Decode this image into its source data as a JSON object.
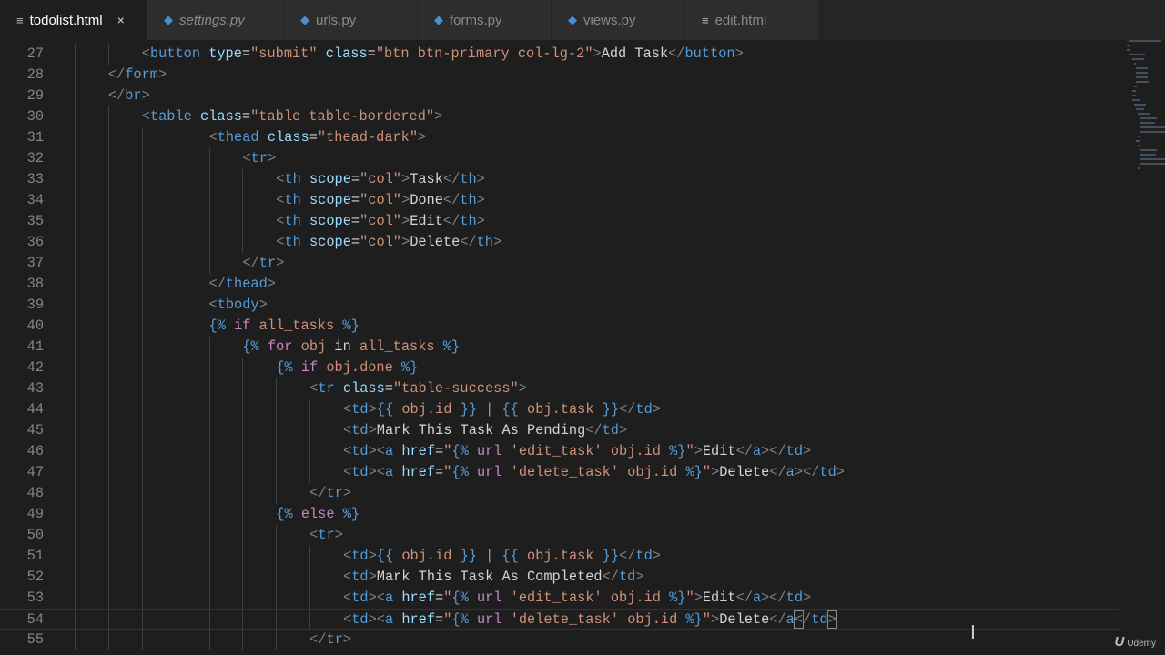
{
  "tabs": [
    {
      "label": "todolist.html",
      "icon": "file-lines-icon",
      "active": true,
      "close": "×"
    },
    {
      "label": "settings.py",
      "icon": "python-icon",
      "italic": true
    },
    {
      "label": "urls.py",
      "icon": "python-icon"
    },
    {
      "label": "forms.py",
      "icon": "python-icon"
    },
    {
      "label": "views.py",
      "icon": "python-icon"
    },
    {
      "label": "edit.html",
      "icon": "file-lines-icon"
    }
  ],
  "lines": [
    {
      "n": "27",
      "i": 8,
      "tk": [
        [
          "p",
          "<"
        ],
        [
          "t",
          "button"
        ],
        [
          "x",
          " "
        ],
        [
          "a",
          "type"
        ],
        [
          "x",
          "="
        ],
        [
          "s",
          "\"submit\""
        ],
        [
          "x",
          " "
        ],
        [
          "a",
          "class"
        ],
        [
          "x",
          "="
        ],
        [
          "s",
          "\"btn btn-primary col-lg-2\""
        ],
        [
          "p",
          ">"
        ],
        [
          "x",
          "Add Task"
        ],
        [
          "p",
          "</"
        ],
        [
          "t",
          "button"
        ],
        [
          "p",
          ">"
        ]
      ]
    },
    {
      "n": "28",
      "i": 4,
      "tk": [
        [
          "p",
          "</"
        ],
        [
          "t",
          "form"
        ],
        [
          "p",
          ">"
        ]
      ]
    },
    {
      "n": "29",
      "i": 4,
      "tk": [
        [
          "p",
          "</"
        ],
        [
          "t",
          "br"
        ],
        [
          "p",
          ">"
        ]
      ]
    },
    {
      "n": "30",
      "i": 8,
      "tk": [
        [
          "p",
          "<"
        ],
        [
          "t",
          "table"
        ],
        [
          "x",
          " "
        ],
        [
          "a",
          "class"
        ],
        [
          "x",
          "="
        ],
        [
          "s",
          "\"table table-bordered\""
        ],
        [
          "p",
          ">"
        ]
      ]
    },
    {
      "n": "31",
      "i": 16,
      "tk": [
        [
          "p",
          "<"
        ],
        [
          "t",
          "thead"
        ],
        [
          "x",
          " "
        ],
        [
          "a",
          "class"
        ],
        [
          "x",
          "="
        ],
        [
          "s",
          "\"thead-dark\""
        ],
        [
          "p",
          ">"
        ]
      ]
    },
    {
      "n": "32",
      "i": 20,
      "tk": [
        [
          "p",
          "<"
        ],
        [
          "t",
          "tr"
        ],
        [
          "p",
          ">"
        ]
      ]
    },
    {
      "n": "33",
      "i": 24,
      "tk": [
        [
          "p",
          "<"
        ],
        [
          "t",
          "th"
        ],
        [
          "x",
          " "
        ],
        [
          "a",
          "scope"
        ],
        [
          "x",
          "="
        ],
        [
          "s",
          "\"col\""
        ],
        [
          "p",
          ">"
        ],
        [
          "x",
          "Task"
        ],
        [
          "p",
          "</"
        ],
        [
          "t",
          "th"
        ],
        [
          "p",
          ">"
        ]
      ]
    },
    {
      "n": "34",
      "i": 24,
      "tk": [
        [
          "p",
          "<"
        ],
        [
          "t",
          "th"
        ],
        [
          "x",
          " "
        ],
        [
          "a",
          "scope"
        ],
        [
          "x",
          "="
        ],
        [
          "s",
          "\"col\""
        ],
        [
          "p",
          ">"
        ],
        [
          "x",
          "Done"
        ],
        [
          "p",
          "</"
        ],
        [
          "t",
          "th"
        ],
        [
          "p",
          ">"
        ]
      ]
    },
    {
      "n": "35",
      "i": 24,
      "tk": [
        [
          "p",
          "<"
        ],
        [
          "t",
          "th"
        ],
        [
          "x",
          " "
        ],
        [
          "a",
          "scope"
        ],
        [
          "x",
          "="
        ],
        [
          "s",
          "\"col\""
        ],
        [
          "p",
          ">"
        ],
        [
          "x",
          "Edit"
        ],
        [
          "p",
          "</"
        ],
        [
          "t",
          "th"
        ],
        [
          "p",
          ">"
        ]
      ]
    },
    {
      "n": "36",
      "i": 24,
      "tk": [
        [
          "p",
          "<"
        ],
        [
          "t",
          "th"
        ],
        [
          "x",
          " "
        ],
        [
          "a",
          "scope"
        ],
        [
          "x",
          "="
        ],
        [
          "s",
          "\"col\""
        ],
        [
          "p",
          ">"
        ],
        [
          "x",
          "Delete"
        ],
        [
          "p",
          "</"
        ],
        [
          "t",
          "th"
        ],
        [
          "p",
          ">"
        ]
      ]
    },
    {
      "n": "37",
      "i": 20,
      "tk": [
        [
          "p",
          "</"
        ],
        [
          "t",
          "tr"
        ],
        [
          "p",
          ">"
        ]
      ]
    },
    {
      "n": "38",
      "i": 16,
      "tk": [
        [
          "p",
          "</"
        ],
        [
          "t",
          "thead"
        ],
        [
          "p",
          ">"
        ]
      ]
    },
    {
      "n": "39",
      "i": 16,
      "tk": [
        [
          "p",
          "<"
        ],
        [
          "t",
          "tbody"
        ],
        [
          "p",
          ">"
        ]
      ]
    },
    {
      "n": "40",
      "i": 16,
      "tk": [
        [
          "d",
          "{%"
        ],
        [
          "x",
          " "
        ],
        [
          "k",
          "if"
        ],
        [
          "x",
          " "
        ],
        [
          "v",
          "all_tasks"
        ],
        [
          "x",
          " "
        ],
        [
          "d",
          "%}"
        ]
      ]
    },
    {
      "n": "41",
      "i": 20,
      "tk": [
        [
          "d",
          "{%"
        ],
        [
          "x",
          " "
        ],
        [
          "k",
          "for"
        ],
        [
          "x",
          " "
        ],
        [
          "v",
          "obj"
        ],
        [
          "x",
          " in "
        ],
        [
          "v",
          "all_tasks"
        ],
        [
          "x",
          " "
        ],
        [
          "d",
          "%}"
        ]
      ]
    },
    {
      "n": "42",
      "i": 24,
      "tk": [
        [
          "d",
          "{%"
        ],
        [
          "x",
          " "
        ],
        [
          "k",
          "if"
        ],
        [
          "x",
          " "
        ],
        [
          "v",
          "obj.done"
        ],
        [
          "x",
          " "
        ],
        [
          "d",
          "%}"
        ]
      ]
    },
    {
      "n": "43",
      "i": 28,
      "tk": [
        [
          "p",
          "<"
        ],
        [
          "t",
          "tr"
        ],
        [
          "x",
          " "
        ],
        [
          "a",
          "class"
        ],
        [
          "x",
          "="
        ],
        [
          "s",
          "\"table-success\""
        ],
        [
          "p",
          ">"
        ]
      ]
    },
    {
      "n": "44",
      "i": 32,
      "tk": [
        [
          "p",
          "<"
        ],
        [
          "t",
          "td"
        ],
        [
          "p",
          ">"
        ],
        [
          "d",
          "{{"
        ],
        [
          "x",
          " "
        ],
        [
          "v",
          "obj.id"
        ],
        [
          "x",
          " "
        ],
        [
          "d",
          "}}"
        ],
        [
          "x",
          " "
        ],
        [
          "k",
          "|"
        ],
        [
          "x",
          " "
        ],
        [
          "d",
          "{{"
        ],
        [
          "x",
          " "
        ],
        [
          "v",
          "obj.task"
        ],
        [
          "x",
          " "
        ],
        [
          "d",
          "}}"
        ],
        [
          "p",
          "</"
        ],
        [
          "t",
          "td"
        ],
        [
          "p",
          ">"
        ]
      ]
    },
    {
      "n": "45",
      "i": 32,
      "tk": [
        [
          "p",
          "<"
        ],
        [
          "t",
          "td"
        ],
        [
          "p",
          ">"
        ],
        [
          "x",
          "Mark This Task As Pending"
        ],
        [
          "p",
          "</"
        ],
        [
          "t",
          "td"
        ],
        [
          "p",
          ">"
        ]
      ]
    },
    {
      "n": "46",
      "i": 32,
      "tk": [
        [
          "p",
          "<"
        ],
        [
          "t",
          "td"
        ],
        [
          "p",
          "><"
        ],
        [
          "t",
          "a"
        ],
        [
          "x",
          " "
        ],
        [
          "a",
          "href"
        ],
        [
          "x",
          "="
        ],
        [
          "s",
          "\""
        ],
        [
          "d",
          "{%"
        ],
        [
          "x",
          " "
        ],
        [
          "k",
          "url"
        ],
        [
          "x",
          " "
        ],
        [
          "s",
          "'edit_task'"
        ],
        [
          "x",
          " "
        ],
        [
          "v",
          "obj.id"
        ],
        [
          "x",
          " "
        ],
        [
          "d",
          "%}"
        ],
        [
          "s",
          "\""
        ],
        [
          "p",
          ">"
        ],
        [
          "x",
          "Edit"
        ],
        [
          "p",
          "</"
        ],
        [
          "t",
          "a"
        ],
        [
          "p",
          "></"
        ],
        [
          "t",
          "td"
        ],
        [
          "p",
          ">"
        ]
      ]
    },
    {
      "n": "47",
      "i": 32,
      "tk": [
        [
          "p",
          "<"
        ],
        [
          "t",
          "td"
        ],
        [
          "p",
          "><"
        ],
        [
          "t",
          "a"
        ],
        [
          "x",
          " "
        ],
        [
          "a",
          "href"
        ],
        [
          "x",
          "="
        ],
        [
          "s",
          "\""
        ],
        [
          "d",
          "{%"
        ],
        [
          "x",
          " "
        ],
        [
          "k",
          "url"
        ],
        [
          "x",
          " "
        ],
        [
          "s",
          "'delete_task'"
        ],
        [
          "x",
          " "
        ],
        [
          "v",
          "obj.id"
        ],
        [
          "x",
          " "
        ],
        [
          "d",
          "%}"
        ],
        [
          "s",
          "\""
        ],
        [
          "p",
          ">"
        ],
        [
          "x",
          "Delete"
        ],
        [
          "p",
          "</"
        ],
        [
          "t",
          "a"
        ],
        [
          "p",
          "></"
        ],
        [
          "t",
          "td"
        ],
        [
          "p",
          ">"
        ]
      ]
    },
    {
      "n": "48",
      "i": 28,
      "tk": [
        [
          "p",
          "</"
        ],
        [
          "t",
          "tr"
        ],
        [
          "p",
          ">"
        ]
      ]
    },
    {
      "n": "49",
      "i": 24,
      "tk": [
        [
          "d",
          "{%"
        ],
        [
          "x",
          " "
        ],
        [
          "k",
          "else"
        ],
        [
          "x",
          " "
        ],
        [
          "d",
          "%}"
        ]
      ]
    },
    {
      "n": "50",
      "i": 28,
      "tk": [
        [
          "p",
          "<"
        ],
        [
          "t",
          "tr"
        ],
        [
          "p",
          ">"
        ]
      ]
    },
    {
      "n": "51",
      "i": 32,
      "tk": [
        [
          "p",
          "<"
        ],
        [
          "t",
          "td"
        ],
        [
          "p",
          ">"
        ],
        [
          "d",
          "{{"
        ],
        [
          "x",
          " "
        ],
        [
          "v",
          "obj.id"
        ],
        [
          "x",
          " "
        ],
        [
          "d",
          "}}"
        ],
        [
          "x",
          " "
        ],
        [
          "k",
          "|"
        ],
        [
          "x",
          " "
        ],
        [
          "d",
          "{{"
        ],
        [
          "x",
          " "
        ],
        [
          "v",
          "obj.task"
        ],
        [
          "x",
          " "
        ],
        [
          "d",
          "}}"
        ],
        [
          "p",
          "</"
        ],
        [
          "t",
          "td"
        ],
        [
          "p",
          ">"
        ]
      ]
    },
    {
      "n": "52",
      "i": 32,
      "tk": [
        [
          "p",
          "<"
        ],
        [
          "t",
          "td"
        ],
        [
          "p",
          ">"
        ],
        [
          "x",
          "Mark This Task As Completed"
        ],
        [
          "p",
          "</"
        ],
        [
          "t",
          "td"
        ],
        [
          "p",
          ">"
        ]
      ]
    },
    {
      "n": "53",
      "i": 32,
      "tk": [
        [
          "p",
          "<"
        ],
        [
          "t",
          "td"
        ],
        [
          "p",
          "><"
        ],
        [
          "t",
          "a"
        ],
        [
          "x",
          " "
        ],
        [
          "a",
          "href"
        ],
        [
          "x",
          "="
        ],
        [
          "s",
          "\""
        ],
        [
          "d",
          "{%"
        ],
        [
          "x",
          " "
        ],
        [
          "k",
          "url"
        ],
        [
          "x",
          " "
        ],
        [
          "s",
          "'edit_task'"
        ],
        [
          "x",
          " "
        ],
        [
          "v",
          "obj.id"
        ],
        [
          "x",
          " "
        ],
        [
          "d",
          "%}"
        ],
        [
          "s",
          "\""
        ],
        [
          "p",
          ">"
        ],
        [
          "x",
          "Edit"
        ],
        [
          "p",
          "</"
        ],
        [
          "t",
          "a"
        ],
        [
          "p",
          "></"
        ],
        [
          "t",
          "td"
        ],
        [
          "p",
          ">"
        ]
      ]
    },
    {
      "n": "54",
      "i": 32,
      "current": true,
      "tk": [
        [
          "p",
          "<"
        ],
        [
          "t",
          "td"
        ],
        [
          "p",
          "><"
        ],
        [
          "t",
          "a"
        ],
        [
          "x",
          " "
        ],
        [
          "a",
          "href"
        ],
        [
          "x",
          "="
        ],
        [
          "s",
          "\""
        ],
        [
          "d",
          "{%"
        ],
        [
          "x",
          " "
        ],
        [
          "k",
          "url"
        ],
        [
          "x",
          " "
        ],
        [
          "s",
          "'delete_task'"
        ],
        [
          "x",
          " "
        ],
        [
          "v",
          "obj.id"
        ],
        [
          "x",
          " "
        ],
        [
          "d",
          "%}"
        ],
        [
          "s",
          "\""
        ],
        [
          "p",
          ">"
        ],
        [
          "x",
          "Delete"
        ],
        [
          "p",
          "</"
        ],
        [
          "t",
          "a"
        ],
        [
          "p br",
          "<"
        ],
        [
          "p",
          "/"
        ],
        [
          "t",
          "td"
        ],
        [
          "p br",
          ">"
        ]
      ]
    },
    {
      "n": "55",
      "i": 28,
      "tk": [
        [
          "p",
          "</"
        ],
        [
          "t",
          "tr"
        ],
        [
          "p",
          ">"
        ]
      ]
    }
  ],
  "watermark": {
    "logo": "U",
    "text": "Udemy"
  }
}
